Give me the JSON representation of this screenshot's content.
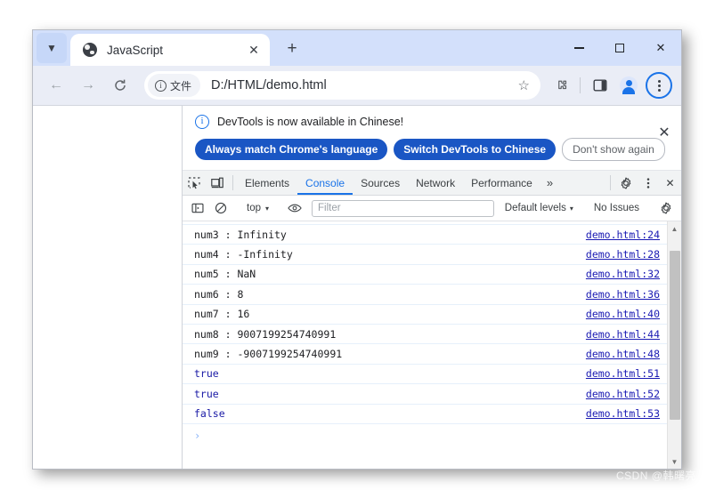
{
  "window": {
    "controls": {
      "minimize": "—",
      "maximize": "□",
      "close": "✕"
    }
  },
  "tabstrip": {
    "tab_search_icon": "chevron-down-icon",
    "tabs": [
      {
        "title": "JavaScript",
        "favicon": "globe-icon",
        "close_label": "✕"
      }
    ],
    "new_tab_label": "+"
  },
  "toolbar": {
    "back_label": "←",
    "forward_label": "→",
    "reload_label": "⟳",
    "file_chip": {
      "info": "i",
      "label": "文件"
    },
    "url": "D:/HTML/demo.html",
    "bookmark_label": "☆",
    "extensions_icon": "puzzle-icon",
    "side_panel_icon": "side-panel-icon",
    "profile_icon": "avatar-icon",
    "menu_icon": "three-dot-menu-icon"
  },
  "devtools": {
    "banner": {
      "icon": "info-icon",
      "message": "DevTools is now available in Chinese!",
      "primary_button": "Always match Chrome's language",
      "secondary_button": "Switch DevTools to Chinese",
      "dismiss_button": "Don't show again",
      "close_label": "✕"
    },
    "tabbar": {
      "inspect_icon": "inspect-element-icon",
      "device_icon": "device-toolbar-icon",
      "tabs": [
        {
          "label": "Elements",
          "active": false
        },
        {
          "label": "Console",
          "active": true
        },
        {
          "label": "Sources",
          "active": false
        },
        {
          "label": "Network",
          "active": false
        },
        {
          "label": "Performance",
          "active": false
        }
      ],
      "more_label": "»",
      "settings_icon": "gear-icon",
      "kebab_icon": "three-dot-menu-icon",
      "close_label": "✕"
    },
    "console_toolbar": {
      "sidebar_icon": "console-sidebar-icon",
      "clear_icon": "clear-console-icon",
      "context": "top",
      "context_caret": "▾",
      "eye_icon": "live-expression-icon",
      "filter_placeholder": "Filter",
      "filter_value": "",
      "levels": "Default levels",
      "levels_caret": "▾",
      "issues": "No Issues",
      "settings_icon": "gear-icon"
    },
    "console_rows": [
      {
        "text": "num3 : Infinity",
        "type": "text",
        "source": "demo.html:24"
      },
      {
        "text": "num4 : -Infinity",
        "type": "text",
        "source": "demo.html:28"
      },
      {
        "text": "num5 : NaN",
        "type": "text",
        "source": "demo.html:32"
      },
      {
        "text": "num6 : 8",
        "type": "text",
        "source": "demo.html:36"
      },
      {
        "text": "num7 : 16",
        "type": "text",
        "source": "demo.html:40"
      },
      {
        "text": "num8 : 9007199254740991",
        "type": "text",
        "source": "demo.html:44"
      },
      {
        "text": "num9 : -9007199254740991",
        "type": "text",
        "source": "demo.html:48"
      },
      {
        "text": "true",
        "type": "bool",
        "source": "demo.html:51"
      },
      {
        "text": "true",
        "type": "bool",
        "source": "demo.html:52"
      },
      {
        "text": "false",
        "type": "bool",
        "source": "demo.html:53"
      }
    ],
    "prompt_symbol": "›",
    "scrollbar": {
      "up": "▲",
      "down": "▼"
    }
  },
  "watermark": "CSDN @韩曙亮",
  "colors": {
    "tabstrip_bg": "#d3e0fb",
    "toolbar_bg": "#eaedf6",
    "accent_blue": "#1a73e8",
    "banner_button": "#1a56c4",
    "console_link": "#1a1ab3",
    "bool_value": "#1a1aa6"
  }
}
